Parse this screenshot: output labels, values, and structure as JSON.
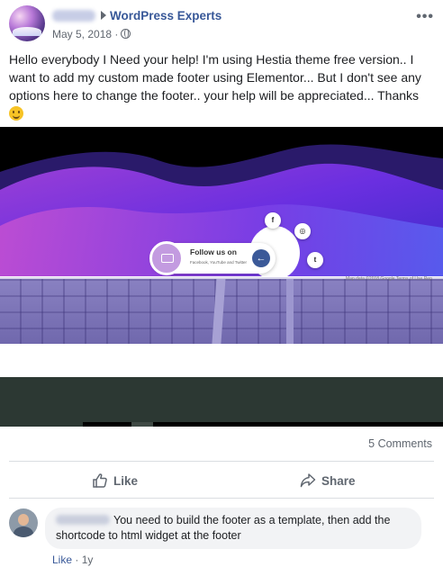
{
  "post": {
    "group_name": "WordPress Experts",
    "date": "May 5, 2018",
    "meta_separator": "·",
    "more_icon": "•••",
    "text": "Hello everybody I Need your help! I'm using Hestia theme free version.. I want to add my custom made footer using Elementor... But I don't see any options here to change the footer.. your help will be appreciated... Thanks",
    "emoji": "smile-emoji"
  },
  "image": {
    "follow_title": "Follow us on",
    "follow_subtitle": "Facebook, YouTube and Twitter",
    "social": {
      "facebook": "f",
      "instagram": "◎",
      "twitter": "t"
    },
    "arrow": "←",
    "map_credits": "Map data ©2018 Google   Terms of Use   Rep",
    "colors": {
      "wave_dark": "#5a1fc2",
      "wave_mid": "#7b3fe0",
      "wave_light": "#b64fd1",
      "footer_bg": "#2c3833"
    }
  },
  "stats": {
    "comments": "5 Comments"
  },
  "actions": {
    "like": "Like",
    "share": "Share"
  },
  "comment": {
    "text": "You need to build the footer as a template, then add the shortcode to html widget at the footer",
    "like": "Like",
    "separator": "·",
    "time": "1y"
  }
}
